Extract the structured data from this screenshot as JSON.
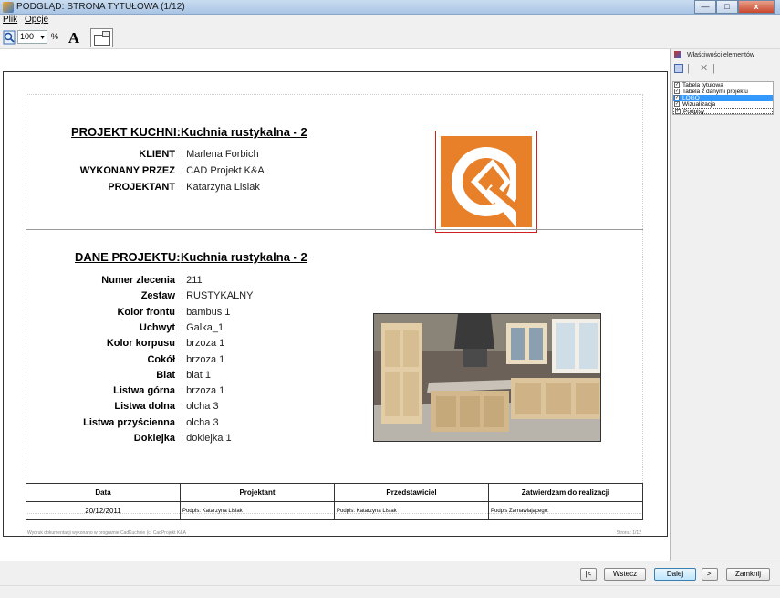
{
  "window": {
    "title": "PODGLĄD: STRONA TYTUŁOWA (1/12)",
    "minimize": "—",
    "maximize": "□",
    "close": "x"
  },
  "menu": [
    {
      "label": "Plik"
    },
    {
      "label": "Opcje"
    }
  ],
  "toolbar": {
    "zoom_value": "100",
    "zoom_unit": "%",
    "font_label": "A"
  },
  "document": {
    "project_title_label": "PROJEKT KUCHNI:",
    "project_title_value": "Kuchnia rustykalna - 2",
    "header_rows": [
      {
        "label": "KLIENT",
        "value": ": Marlena Forbich"
      },
      {
        "label": "WYKONANY PRZEZ",
        "value": ": CAD Projekt K&A"
      },
      {
        "label": "PROJEKTANT",
        "value": ": Katarzyna Lisiak"
      }
    ],
    "data_title_label": "DANE PROJEKTU:",
    "data_title_value": "Kuchnia rustykalna - 2",
    "data_rows": [
      {
        "label": "Numer zlecenia",
        "value": ": 211"
      },
      {
        "label": "Zestaw",
        "value": ": RUSTYKALNY"
      },
      {
        "label": "Kolor frontu",
        "value": ": bambus 1"
      },
      {
        "label": "Uchwyt",
        "value": ": Galka_1"
      },
      {
        "label": "Kolor korpusu",
        "value": ": brzoza 1"
      },
      {
        "label": "Cokół",
        "value": ": brzoza 1"
      },
      {
        "label": "Blat",
        "value": ": blat 1"
      },
      {
        "label": "Listwa górna",
        "value": ": brzoza 1"
      },
      {
        "label": "Listwa dolna",
        "value": ": olcha 3"
      },
      {
        "label": "Listwa przyścienna",
        "value": ": olcha 3"
      },
      {
        "label": "Doklejka",
        "value": ": doklejka 1"
      }
    ],
    "signature_table": {
      "headers": [
        "Data",
        "Projektant",
        "Przedstawiciel",
        "Zatwierdzam do realizacji"
      ],
      "cells": [
        "20/12/2011",
        "Podpis: Katarzyna Lisiak",
        "Podpis: Katarzyna Lisiak",
        "Podpis Zamawiającego:"
      ]
    },
    "footer_left": "Wydruk dokumentacji wykonano w programie CadKuchnie (c) CadProjekt K&A",
    "footer_right": "Strona: 1/12",
    "logo_color": "#e8802a"
  },
  "properties_panel": {
    "title": "Właściwości elementów",
    "items": [
      {
        "label": "Tabela tytułowa",
        "checked": true
      },
      {
        "label": "Tabela z danymi projektu",
        "checked": true
      },
      {
        "label": "LOGO",
        "checked": true,
        "selected": true
      },
      {
        "label": "Wizualizacja",
        "checked": true
      },
      {
        "label": "Podpisy",
        "checked": true
      }
    ]
  },
  "navigation": {
    "first": "|<",
    "back": "Wstecz",
    "next": "Dalej",
    "last": ">|",
    "close": "Zamknij"
  }
}
